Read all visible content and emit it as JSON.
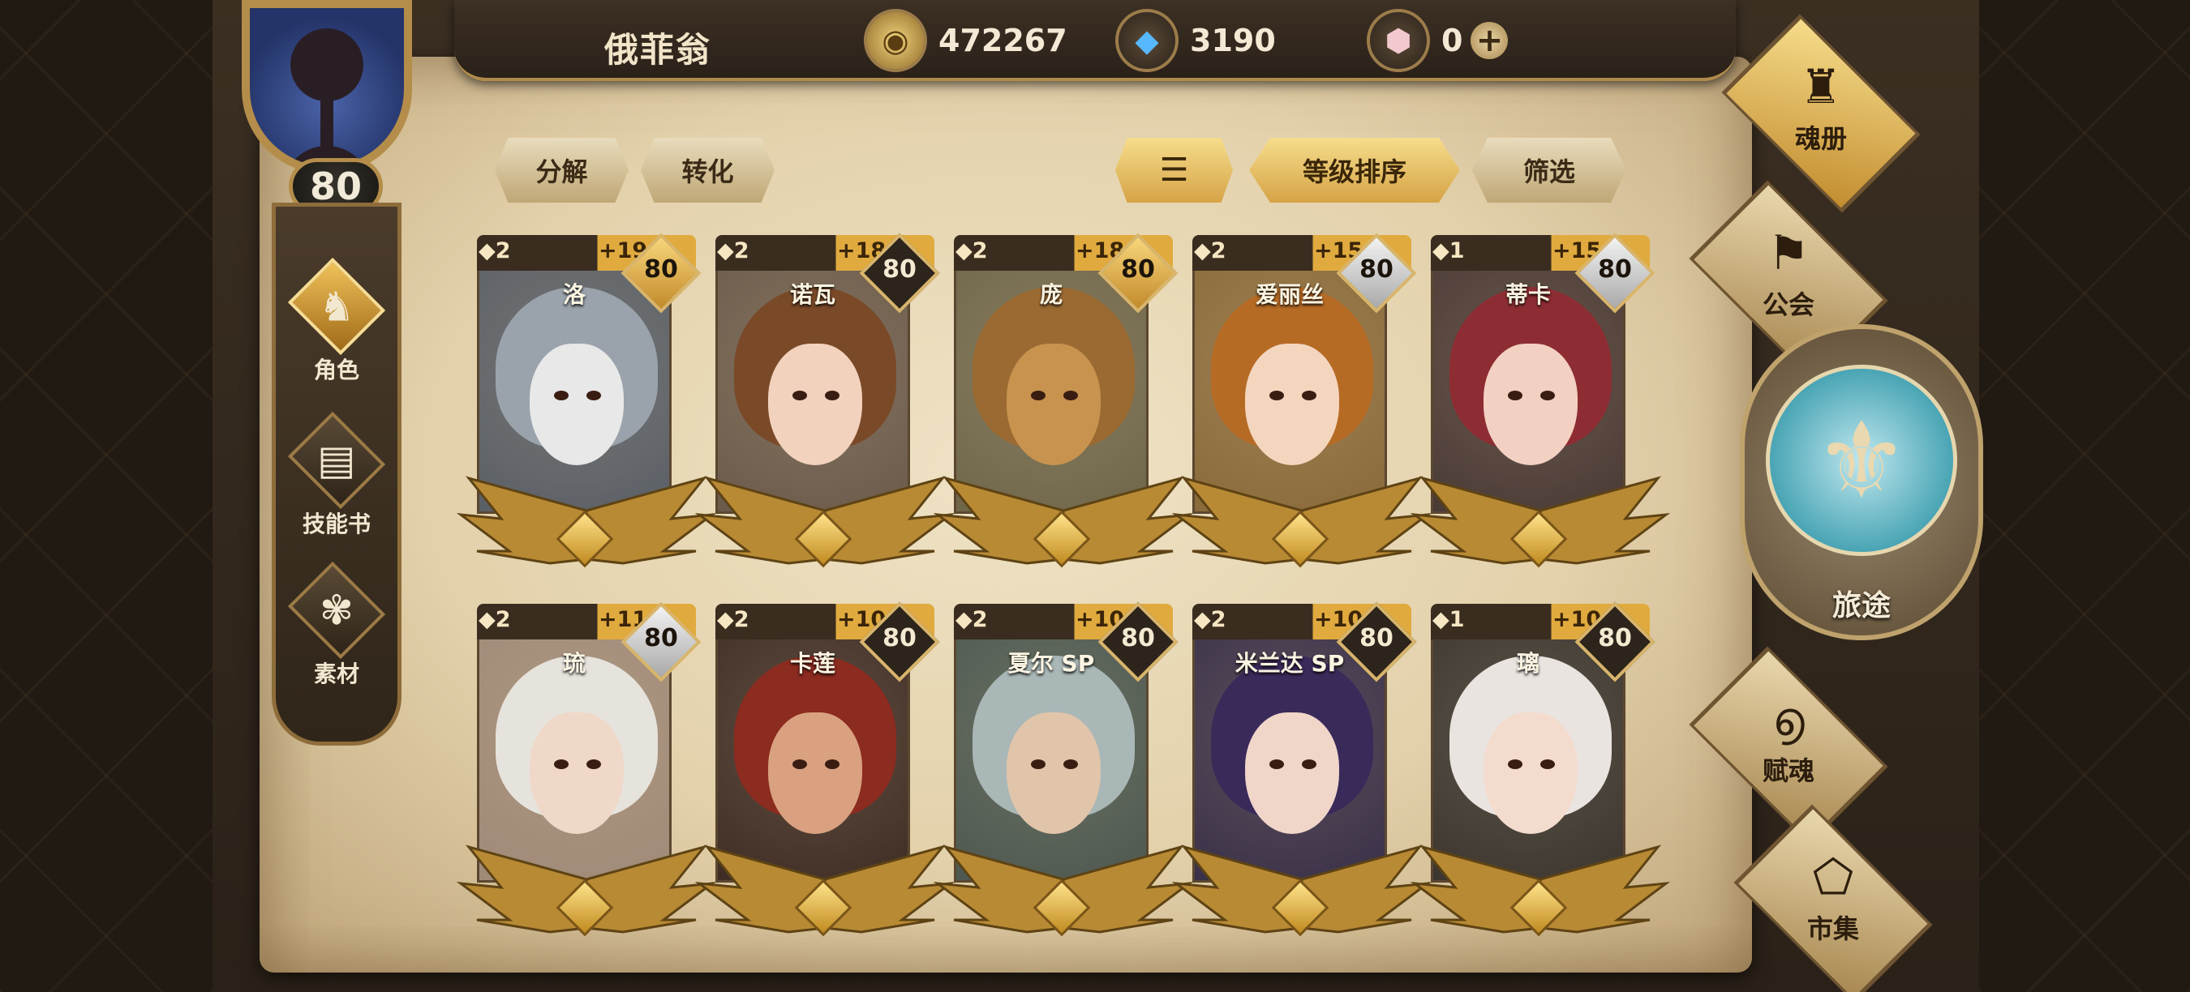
{
  "player": {
    "name": "俄菲翁",
    "level": "80"
  },
  "resources": [
    {
      "icon": "gold-coin-icon",
      "value": "472267"
    },
    {
      "icon": "blue-crystal-icon",
      "value": "3190"
    },
    {
      "icon": "pink-gem-icon",
      "value": "0"
    }
  ],
  "left_nav": [
    {
      "label": "角色",
      "icon": "character-icon",
      "active": true
    },
    {
      "label": "技能书",
      "icon": "skillbook-icon",
      "active": false
    },
    {
      "label": "素材",
      "icon": "material-icon",
      "active": false
    }
  ],
  "toolbar": {
    "decompose": "分解",
    "convert": "转化",
    "sort_by": "等级排序",
    "filter": "筛选"
  },
  "cards": [
    {
      "name": "洛",
      "rank": "2",
      "bonus": "+19",
      "level": "80",
      "badge": "gold"
    },
    {
      "name": "诺瓦",
      "rank": "2",
      "bonus": "+18",
      "level": "80",
      "badge": "dark"
    },
    {
      "name": "庞",
      "rank": "2",
      "bonus": "+18",
      "level": "80",
      "badge": "gold"
    },
    {
      "name": "爱丽丝",
      "rank": "2",
      "bonus": "+15",
      "level": "80",
      "badge": "silver"
    },
    {
      "name": "蒂卡",
      "rank": "1",
      "bonus": "+15",
      "level": "80",
      "badge": "silver"
    },
    {
      "name": "琉",
      "rank": "2",
      "bonus": "+11",
      "level": "80",
      "badge": "silver"
    },
    {
      "name": "卡莲",
      "rank": "2",
      "bonus": "+10",
      "level": "80",
      "badge": "dark"
    },
    {
      "name": "夏尔 SP",
      "rank": "2",
      "bonus": "+10",
      "level": "80",
      "badge": "dark"
    },
    {
      "name": "米兰达 SP",
      "rank": "2",
      "bonus": "+10",
      "level": "80",
      "badge": "dark"
    },
    {
      "name": "璃",
      "rank": "1",
      "bonus": "+10",
      "level": "80",
      "badge": "dark"
    }
  ],
  "right_nav": {
    "soulbook": "魂册",
    "guild": "公会",
    "journey": "旅途",
    "endow": "赋魂",
    "market": "市集"
  },
  "colors": {
    "accent_gold": "#e0aa3e",
    "parchment": "#e3d1ab",
    "journey_teal": "#4aa5b5"
  }
}
